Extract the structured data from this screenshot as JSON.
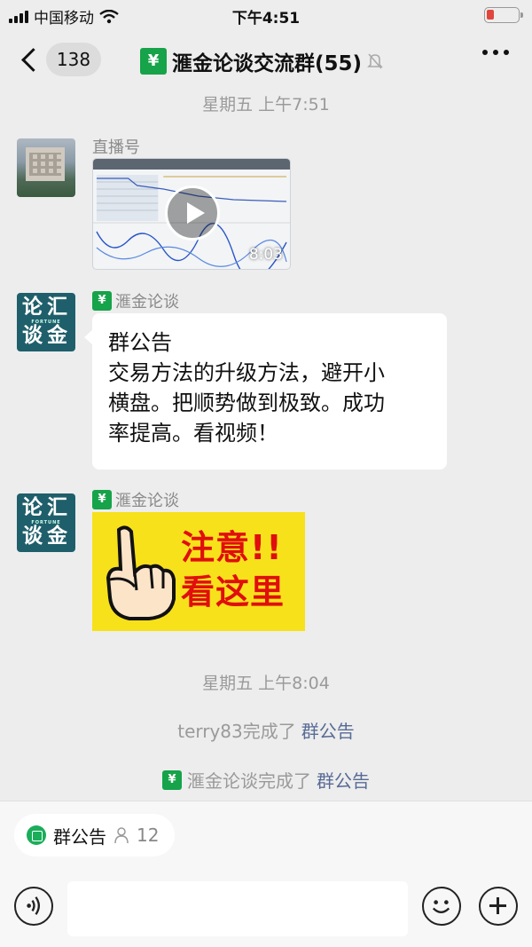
{
  "status_bar": {
    "carrier": "中国移动",
    "time": "下午4:51",
    "battery_color": "#e0463c"
  },
  "nav": {
    "unread_count": "138",
    "group_title": "滙金论谈交流群(55)",
    "logo_glyph": "¥"
  },
  "chat": {
    "messages": [
      {
        "timestamp": "星期五 上午7:51",
        "sender": "直播号",
        "type": "video",
        "duration": "8:03"
      },
      {
        "sender": "滙金论谈",
        "type": "announcement",
        "lines": [
          "群公告",
          "交易方法的升级方法，避开小",
          "横盘。把顺势做到极致。成功",
          "率提高。看视频！"
        ]
      },
      {
        "sender": "滙金论谈",
        "type": "sticker",
        "sticker_lines": [
          "注意!!",
          "看这里"
        ]
      }
    ],
    "timestamp2": "星期五 上午8:04",
    "system_1": {
      "text": "terry83完成了",
      "link": "群公告"
    },
    "system_2": {
      "text": "滙金论谈完成了",
      "link": "群公告"
    }
  },
  "avatar_brand": {
    "chars": [
      "论",
      "汇",
      "谈",
      "金"
    ],
    "subtitle": "FORTUNE"
  },
  "bottom": {
    "announcement_label": "群公告",
    "read_count": "12"
  },
  "icons": {
    "back": "chevron-left-icon",
    "mute": "bell-off-icon",
    "more": "more-dots-icon",
    "voice": "voice-icon",
    "emoji": "emoji-icon",
    "plus": "plus-icon"
  },
  "colors": {
    "link": "#576b95",
    "background": "#ededed",
    "brand_green": "#16a34a",
    "sticker_yellow": "#f7e11b",
    "sticker_red": "#e00e0e"
  }
}
